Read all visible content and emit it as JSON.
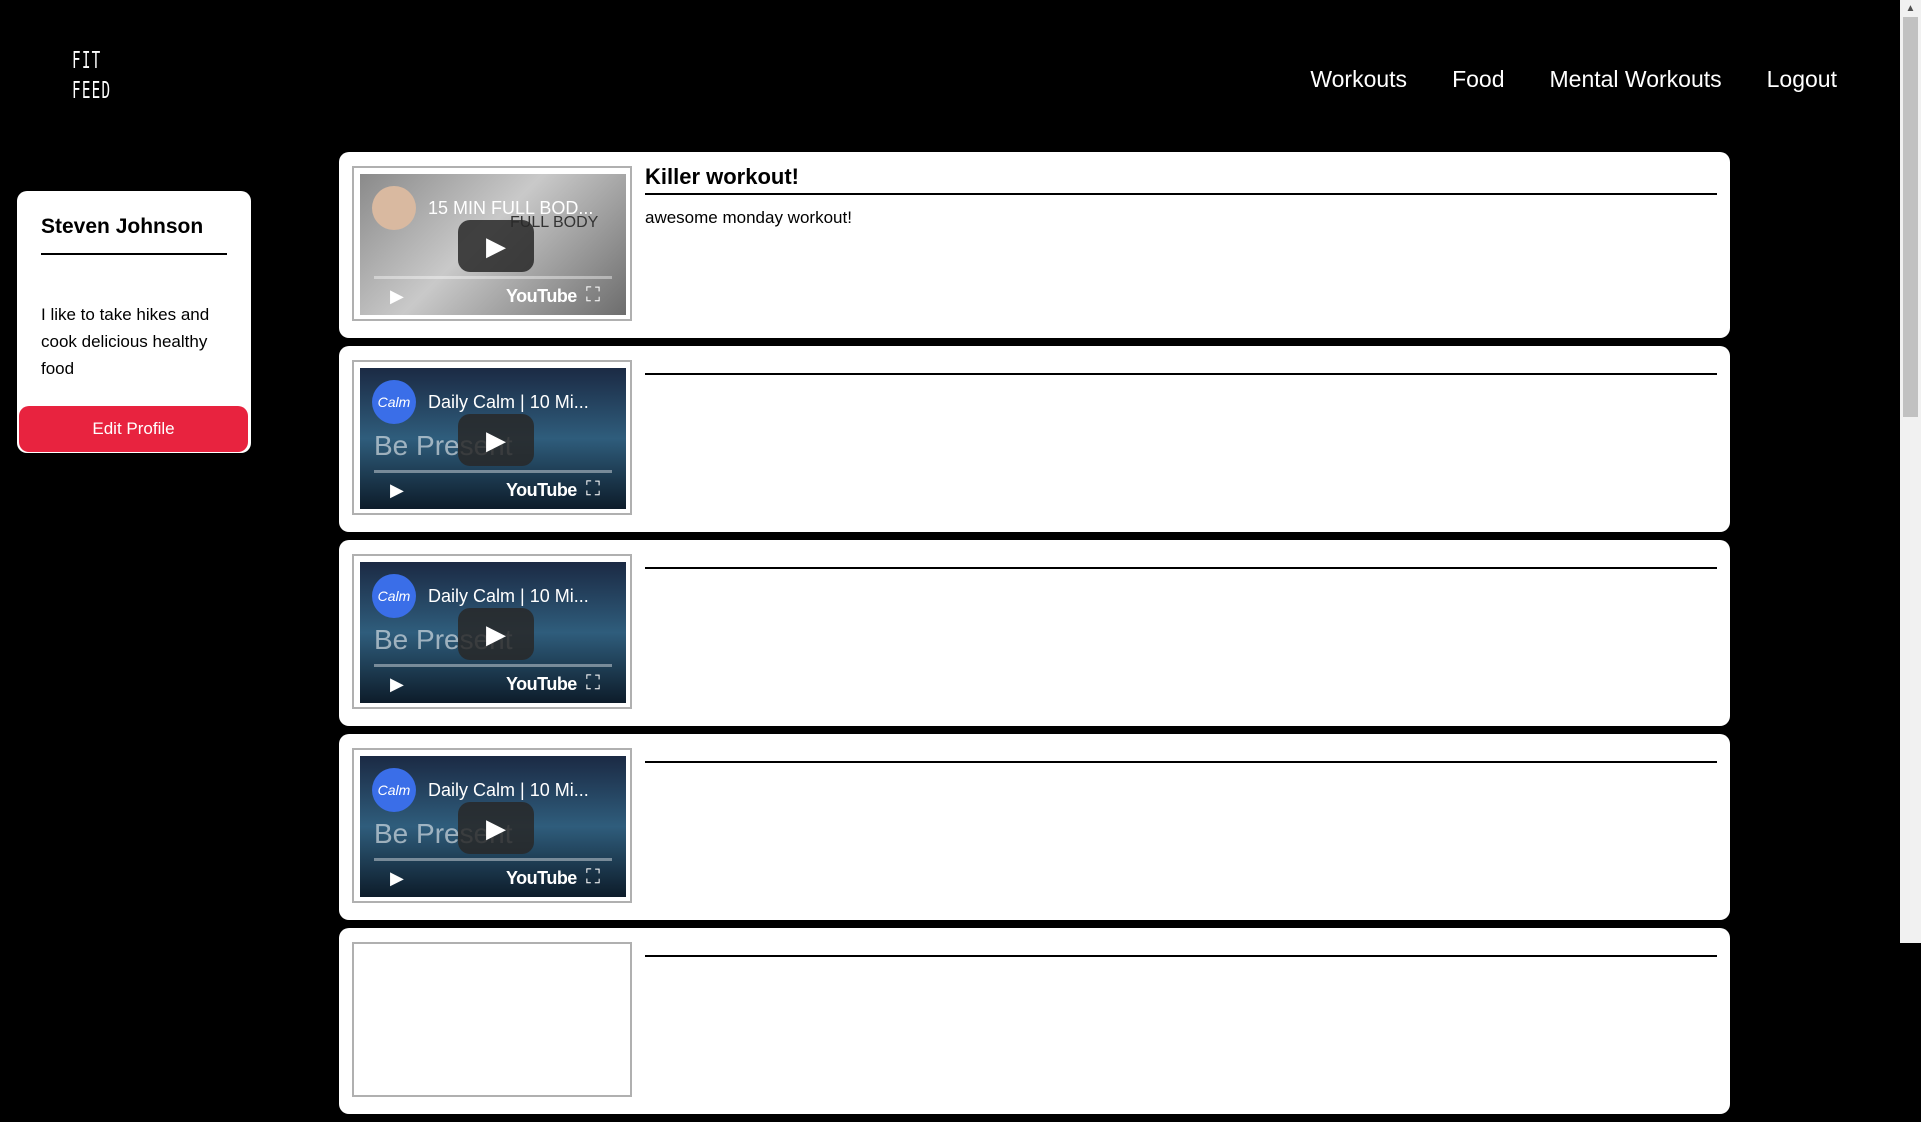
{
  "app": {
    "logo_line1": "FIT",
    "logo_line2": "FEED"
  },
  "nav": {
    "items": [
      "Workouts",
      "Food",
      "Mental Workouts",
      "Logout"
    ]
  },
  "profile": {
    "name": "Steven Johnson",
    "bio": "I like to take hikes and cook delicious healthy food",
    "edit_label": "Edit Profile"
  },
  "video": {
    "yt_label": "YouTube"
  },
  "posts": [
    {
      "title": "Killer workout!",
      "body": "awesome monday workout!",
      "video_title": "15 MIN FULL BOD...",
      "video_overlay": "FULL BODY",
      "avatar_text": ""
    },
    {
      "title": "",
      "body": "",
      "video_title": "Daily Calm | 10 Mi...",
      "video_overlay": "Be Present",
      "avatar_text": "Calm"
    },
    {
      "title": "",
      "body": "",
      "video_title": "Daily Calm | 10 Mi...",
      "video_overlay": "Be Present",
      "avatar_text": "Calm"
    },
    {
      "title": "",
      "body": "",
      "video_title": "Daily Calm | 10 Mi...",
      "video_overlay": "Be Present",
      "avatar_text": "Calm"
    },
    {
      "title": "",
      "body": "",
      "video_title": "",
      "video_overlay": "",
      "avatar_text": ""
    }
  ],
  "colors": {
    "background": "#000000",
    "card": "#ffffff",
    "accent": "#e8233f"
  }
}
